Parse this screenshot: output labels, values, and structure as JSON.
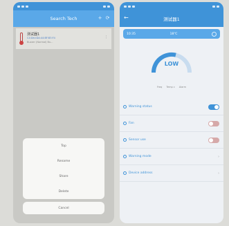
{
  "left_screen": {
    "title": "Search Tech",
    "device": {
      "name": "测试器1",
      "mac": "C4:Dev:DA:44:BF:B3:F4",
      "sub": "Buzzer (Normal) Bu..."
    },
    "action_sheet": {
      "options": [
        "Top",
        "Rename",
        "Share",
        "Delete"
      ],
      "cancel": "Cancel"
    }
  },
  "right_screen": {
    "title": "测试器1",
    "info_bar": {
      "time": "10:35",
      "temp": "18℃"
    },
    "gauge": {
      "label": "LOW"
    },
    "sub_row": [
      "Freq",
      "Temp c",
      "Alarm"
    ],
    "settings": [
      {
        "label": "Warning status",
        "type": "toggle",
        "state": "on"
      },
      {
        "label": "Fan",
        "type": "toggle",
        "state": "off"
      },
      {
        "label": "Sensor use",
        "type": "toggle",
        "state": "off"
      },
      {
        "label": "Warning mode",
        "type": "select",
        "value": ""
      },
      {
        "label": "Device address",
        "type": "select",
        "value": ""
      }
    ]
  },
  "colors": {
    "accent": "#3f93d8",
    "toggle_off": "#d6a9a9"
  }
}
